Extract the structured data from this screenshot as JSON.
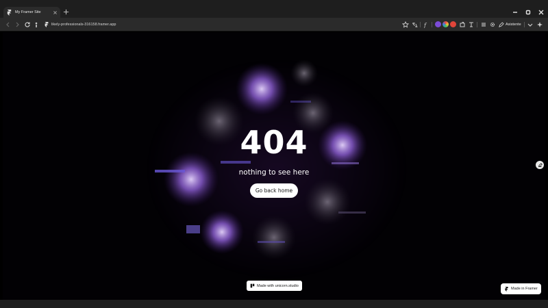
{
  "browser": {
    "tab_title": "My Framer Site",
    "url": "likely-professionals-316158.framer.app",
    "assistant_label": "Asistente",
    "extension_colors": [
      "#7b4bd6",
      "#36c06b",
      "#e0453a"
    ]
  },
  "page": {
    "error_code": "404",
    "message": "nothing to see here",
    "home_button_label": "Go back home",
    "unicorn_badge": "Made with unicorn.studio",
    "framer_badge": "Made in Framer",
    "accent_color": "#a06cf0"
  }
}
